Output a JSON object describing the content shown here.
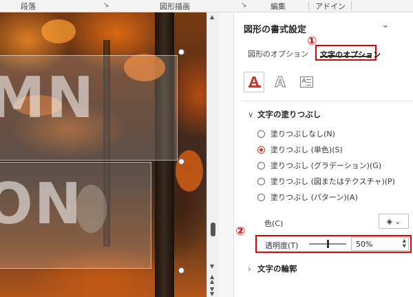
{
  "ribbon": {
    "groups": [
      "段落",
      "図形描画",
      "編集",
      "アドイン"
    ]
  },
  "canvas": {
    "text_line1": "MN",
    "text_line2": "ON"
  },
  "pane": {
    "title": "図形の書式設定",
    "tabs": {
      "shape_options": "図形のオプション",
      "text_options": "文字のオプション"
    },
    "callout_1": "①",
    "callout_2": "②",
    "icons": [
      "text-fill-outline-icon",
      "text-effects-icon",
      "textbox-icon"
    ],
    "fill_section": {
      "title": "文字の塗りつぶし",
      "options": [
        {
          "label": "塗りつぶしなし(N)",
          "selected": false
        },
        {
          "label": "塗りつぶし (単色)(S)",
          "selected": true
        },
        {
          "label": "塗りつぶし (グラデーション)(G)",
          "selected": false
        },
        {
          "label": "塗りつぶし (図またはテクスチャ)(P)",
          "selected": false
        },
        {
          "label": "塗りつぶし (パターン)(A)",
          "selected": false
        }
      ],
      "color_label": "色(C)",
      "transparency_label": "透明度(T)",
      "transparency_value": "50%",
      "transparency_fraction": 0.5
    },
    "outline_section": {
      "title": "文字の輪郭"
    }
  },
  "colors": {
    "highlight_red": "#e00000",
    "radio_selected": "#c43e1c"
  }
}
